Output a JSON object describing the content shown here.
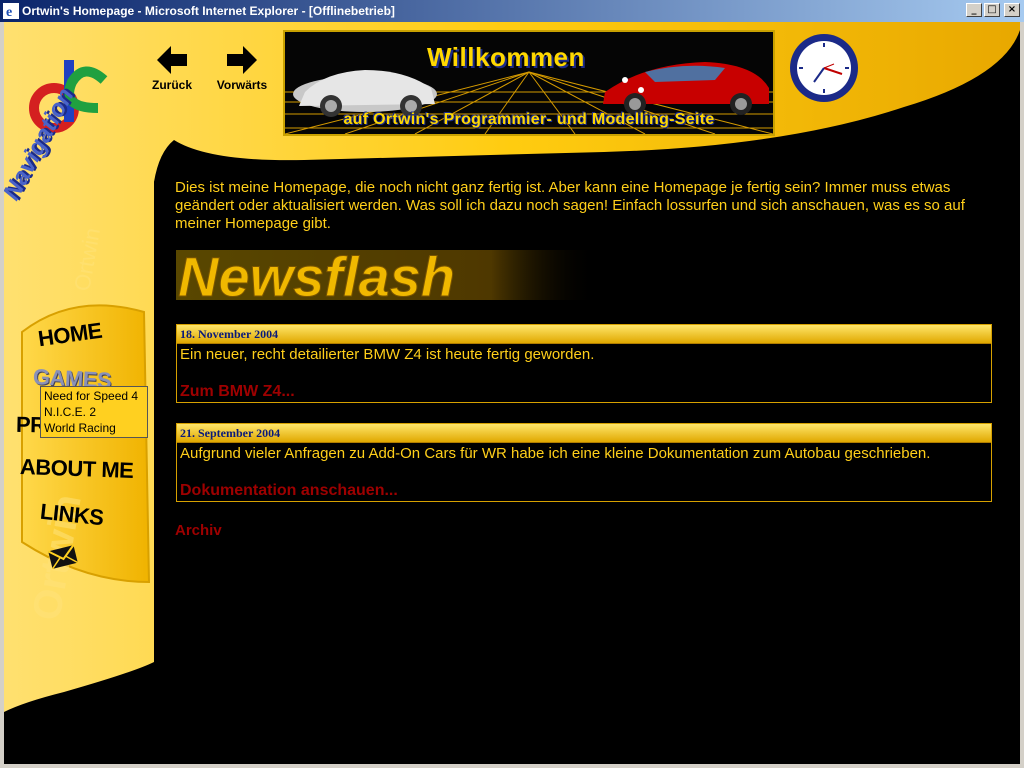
{
  "window": {
    "title": "Ortwin's Homepage - Microsoft Internet Explorer - [Offlinebetrieb]"
  },
  "header": {
    "back_label": "Zurück",
    "forward_label": "Vorwärts",
    "banner_title": "Willkommen",
    "banner_subtitle": "auf Ortwin's Programmier- und Modelling-Seite"
  },
  "sidebar": {
    "title": "Navigation",
    "items": [
      {
        "label": "HOME"
      },
      {
        "label": "GAMES"
      },
      {
        "label": "PROGRAMS"
      },
      {
        "label": "ABOUT ME"
      },
      {
        "label": "LINKS"
      }
    ],
    "games_submenu": [
      "Need for Speed 4",
      "N.I.C.E. 2",
      "World Racing"
    ]
  },
  "main": {
    "intro": "Dies ist meine Homepage, die noch nicht ganz fertig ist. Aber kann eine Homepage je fertig sein? Immer muss etwas geändert oder aktualisiert werden. Was soll ich dazu noch sagen! Einfach lossurfen und sich anschauen, was es so auf meiner Homepage gibt.",
    "newsflash_heading": "Newsflash",
    "news": [
      {
        "date": "18. November 2004",
        "text": "Ein neuer, recht detailierter BMW Z4 ist heute fertig geworden.",
        "link": "Zum BMW Z4..."
      },
      {
        "date": "21. September 2004",
        "text": "Aufgrund vieler Anfragen zu Add-On Cars für WR habe ich eine kleine Dokumentation zum Autobau geschrieben.",
        "link": "Dokumentation anschauen..."
      }
    ],
    "archive_label": "Archiv"
  },
  "colors": {
    "accent_yellow": "#ffcf1a",
    "link_red": "#9e0000",
    "nav_blue": "#1b2a88"
  }
}
